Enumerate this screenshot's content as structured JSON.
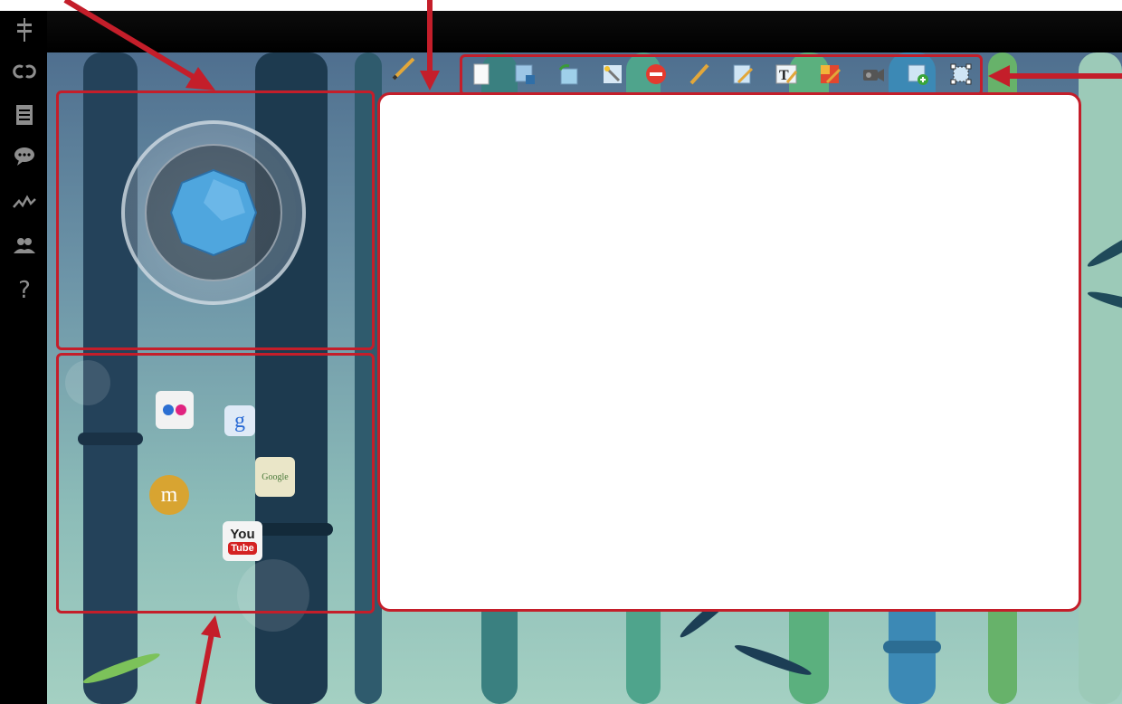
{
  "app": {
    "sidebar_icons": [
      "signpost-icon",
      "link-icon",
      "notepad-icon",
      "chat-bubble-icon",
      "activity-graph-icon",
      "users-icon",
      "help-icon"
    ],
    "help_glyph": "?"
  },
  "toolbar": {
    "tools": [
      "new-page-icon",
      "save-page-icon",
      "rotate-page-icon",
      "magic-wand-icon",
      "delete-icon",
      "pencil-icon",
      "draw-on-page-icon",
      "text-tool-icon",
      "color-fill-icon",
      "video-camera-icon",
      "add-page-icon",
      "selection-frame-icon"
    ]
  },
  "apps": {
    "items": [
      {
        "name": "flickr",
        "icon": "flickr-icon",
        "label": ""
      },
      {
        "name": "google",
        "icon": "google-icon",
        "label": "g"
      },
      {
        "name": "google-maps",
        "icon": "google-maps-icon",
        "label": "Google"
      },
      {
        "name": "moodle",
        "icon": "moodle-icon",
        "label": "m"
      },
      {
        "name": "youtube",
        "icon": "youtube-icon",
        "label_top": "You",
        "label_bottom": "Tube"
      }
    ]
  },
  "colors": {
    "highlight": "#c41e2a",
    "sidebar_bg": "#000000",
    "canvas_bg": "#ffffff"
  }
}
